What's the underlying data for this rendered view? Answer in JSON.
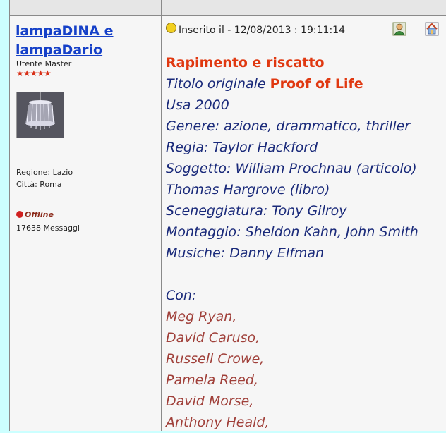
{
  "author": {
    "name": "lampaDINA e lampaDario",
    "rank": "Utente Master",
    "stars": "★★★★★",
    "region_label": "Regione: Lazio",
    "city_label": "Città: Roma",
    "status": "Offline",
    "messages": "17638 Messaggi"
  },
  "post": {
    "meta": "Inserito il - 12/08/2013 : 19:11:14",
    "title": "Rapimento e riscatto",
    "original_title_label": "Titolo originale",
    "original_title": "Proof of Life",
    "lines": [
      "Usa 2000",
      "Genere: azione, drammatico, thriller",
      "Regia: Taylor Hackford",
      "Soggetto: William Prochnau (articolo)",
      "Thomas Hargrove (libro)",
      "Sceneggiatura: Tony Gilroy",
      "Montaggio: Sheldon Kahn, John Smith",
      "Musiche: Danny Elfman"
    ],
    "cast_label": "Con:",
    "cast": [
      "Meg Ryan,",
      "David Caruso,",
      "Russell Crowe,",
      "Pamela Reed,",
      "David Morse,",
      "Anthony Heald,"
    ]
  },
  "icons": {
    "profile": "profile-icon",
    "home": "home-icon"
  }
}
